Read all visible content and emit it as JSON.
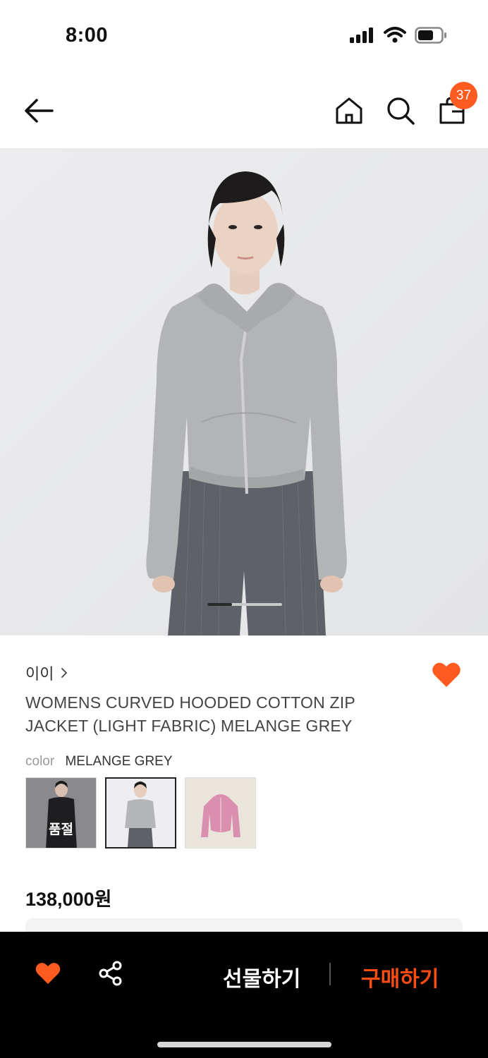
{
  "status_bar": {
    "time": "8:00"
  },
  "header": {
    "cart_count": "37"
  },
  "gallery": {
    "current_index": 1,
    "total": 3
  },
  "product": {
    "brand": "이이",
    "title": "WOMENS CURVED HOODED COTTON ZIP JACKET (LIGHT FABRIC) MELANGE GREY",
    "color_label": "color",
    "color_value": "MELANGE GREY",
    "swatches": [
      {
        "color": "black",
        "badge": "품절",
        "sold_out": true
      },
      {
        "color": "melange grey",
        "badge": "",
        "selected": true
      },
      {
        "color": "pink",
        "badge": ""
      }
    ],
    "price": "138,000원",
    "wished": true
  },
  "bottom_bar": {
    "gift_label": "선물하기",
    "buy_label": "구매하기"
  },
  "colors": {
    "accent": "#ff5a1f",
    "buy": "#ff4d12",
    "bar_bg": "#000000"
  }
}
